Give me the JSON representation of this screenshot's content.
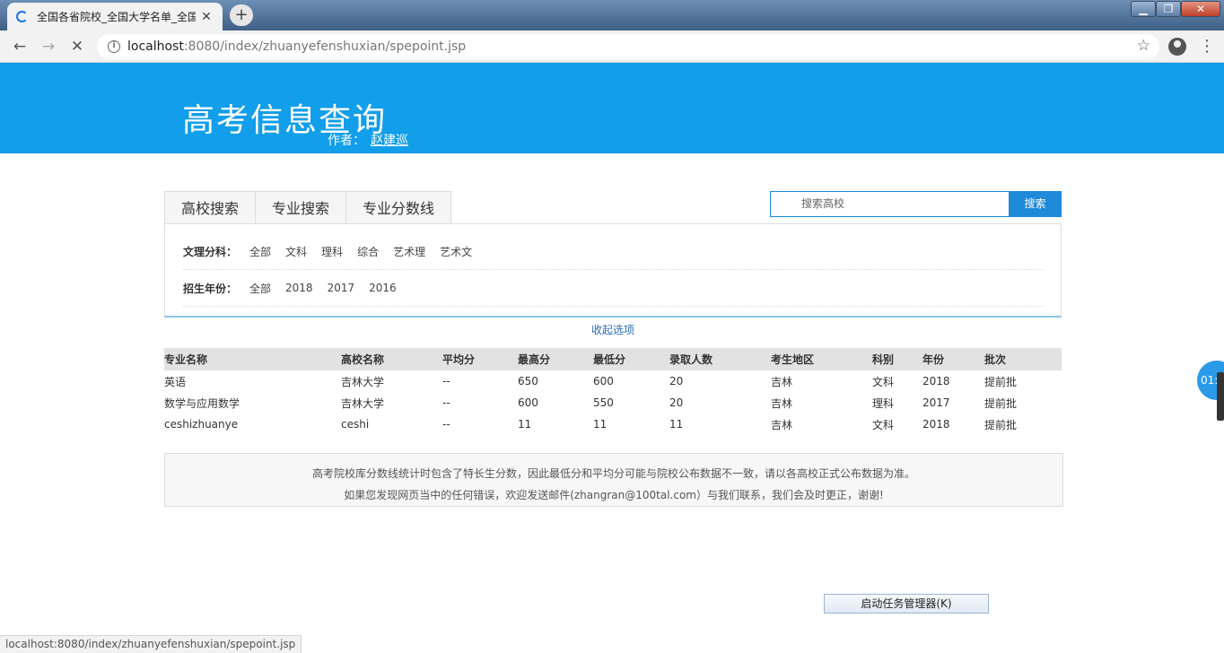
{
  "browser": {
    "tab_title": "全国各省院校_全国大学名单_全国",
    "url_host": "localhost",
    "url_path": ":8080/index/zhuanyefenshuxian/spepoint.jsp",
    "status_url": "localhost:8080/index/zhuanyefenshuxian/spepoint.jsp"
  },
  "header": {
    "title": "高考信息查询",
    "author_label": "作者：",
    "author_name": "赵建巡"
  },
  "nav": {
    "tabs": [
      "高校搜索",
      "专业搜索",
      "专业分数线"
    ]
  },
  "search": {
    "placeholder": "搜索高校",
    "button": "搜索"
  },
  "filters": {
    "subject": {
      "label": "文理分科：",
      "options": [
        "全部",
        "文科",
        "理科",
        "综合",
        "艺术理",
        "艺术文"
      ]
    },
    "year": {
      "label": "招生年份：",
      "options": [
        "全部",
        "2018",
        "2017",
        "2016"
      ]
    },
    "collapse_label": "收起选项"
  },
  "table": {
    "headers": [
      "专业名称",
      "高校名称",
      "平均分",
      "最高分",
      "最低分",
      "录取人数",
      "考生地区",
      "科别",
      "年份",
      "批次"
    ],
    "rows": [
      [
        "英语",
        "吉林大学",
        "--",
        "650",
        "600",
        "20",
        "吉林",
        "文科",
        "2018",
        "提前批"
      ],
      [
        "数学与应用数学",
        "吉林大学",
        "--",
        "600",
        "550",
        "20",
        "吉林",
        "理科",
        "2017",
        "提前批"
      ],
      [
        "ceshizhuanye",
        "ceshi",
        "--",
        "11",
        "11",
        "11",
        "吉林",
        "文科",
        "2018",
        "提前批"
      ]
    ]
  },
  "notice": {
    "line1": "高考院校库分数线统计时包含了特长生分数，因此最低分和平均分可能与院校公布数据不一致，请以各高校正式公布数据为准。",
    "line2": "如果您发现网页当中的任何错误，欢迎发送邮件(zhangran@100tal.com）与我们联系，我们会及时更正，谢谢!"
  },
  "taskbar": {
    "task_manager": "启动任务管理器(K)"
  },
  "side_widget_text": "01:"
}
